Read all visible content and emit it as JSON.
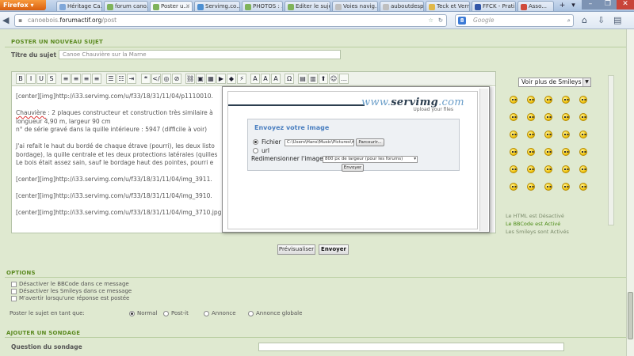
{
  "browser": {
    "app_button": "Firefox",
    "tabs": [
      {
        "label": "Héritage Ca...",
        "color": "#7fa7d9"
      },
      {
        "label": "forum cano...",
        "color": "#7fb35a"
      },
      {
        "label": "Poster u...",
        "color": "#7fb35a",
        "active": true
      },
      {
        "label": "Servimg.co...",
        "color": "#4d8fd1"
      },
      {
        "label": "PHOTOS : ...",
        "color": "#7fb35a"
      },
      {
        "label": "Editer le sujet",
        "color": "#7fb35a"
      },
      {
        "label": "Voies navig...",
        "color": "#bfbfbf"
      },
      {
        "label": "auboutdesp...",
        "color": "#bfbfbf"
      },
      {
        "label": "Teck et Vernis",
        "color": "#e0b84a"
      },
      {
        "label": "FFCK - Prati...",
        "color": "#3156a8"
      },
      {
        "label": "Asso...",
        "color": "#d04a3a"
      }
    ],
    "url_domain": "canoebois.",
    "url_host": "forumactif.org",
    "url_path": "/post",
    "search_placeholder": "Google",
    "search_engine_letter": "8"
  },
  "form": {
    "new_topic_heading": "POSTER UN NOUVEAU SUJET",
    "subject_label": "Titre du sujet",
    "subject_value": "Canoe Chauvière sur la Marne",
    "editor_lines": [
      "[center][img]http://i33.servimg.com/u/f33/18/31/11/04/p1110010.",
      "",
      "Chauvière : 2 plaques constructeur et construction très similaire à",
      "longueur 4,90 m, largeur 90 cm",
      "n° de série gravé dans la quille intérieure : 5947 (difficile à voir)",
      "",
      "J'ai refait le haut du bordé de chaque étrave (pourri), les deux listo",
      "bordage), la quille centrale et les deux protections latérales (quilles",
      "Le bois était assez sain, sauf le bordage haut des pointes, pourri e",
      "",
      "[center][img]http://i33.servimg.com/u/f33/18/31/11/04/img_3911.",
      "",
      "[center][img]http://i33.servimg.com/u/f33/18/31/11/04/img_3910.",
      "",
      "[center][img]http://i33.servimg.com/u/f33/18/31/11/04/img_3710.jpg[/img][/center]"
    ],
    "preview_button": "Prévisualiser",
    "send_button": "Envoyer"
  },
  "upload_popup": {
    "logo_prefix": "www.",
    "logo_name": "servimg",
    "logo_suffix": ".com",
    "logo_tagline": "Upload your files",
    "title": "Envoyez votre image",
    "file_label": "Fichier",
    "file_path": "C:\\Users\\Hans\\Music\\Pictures\\# CANOES #",
    "browse_button": "Parcourir...",
    "url_label": "url",
    "resize_label": "Redimensionner l'image",
    "resize_value": "800 px de largeur (pour les forums)",
    "send_button": "Envoyer"
  },
  "smileys": {
    "select_value": "Voir plus de Smileys",
    "count": 30,
    "status": [
      {
        "text": "Le HTML est Désactivé",
        "on": false
      },
      {
        "text": "Le BBCode est Activé",
        "on": true
      },
      {
        "text": "Les Smileys sont Activés",
        "on": false
      }
    ]
  },
  "options": {
    "heading": "OPTIONS",
    "checkboxes": [
      "Désactiver le BBCode dans ce message",
      "Désactiver les Smileys dans ce message",
      "M'avertir lorsqu'une réponse est postée"
    ],
    "post_as_label": "Poster le sujet en tant que:",
    "post_types": [
      {
        "label": "Normal",
        "checked": true
      },
      {
        "label": "Post-it",
        "checked": false
      },
      {
        "label": "Annonce",
        "checked": false
      },
      {
        "label": "Annonce globale",
        "checked": false
      }
    ]
  },
  "poll": {
    "heading": "AJOUTER UN SONDAGE",
    "question_label": "Question du sondage"
  }
}
